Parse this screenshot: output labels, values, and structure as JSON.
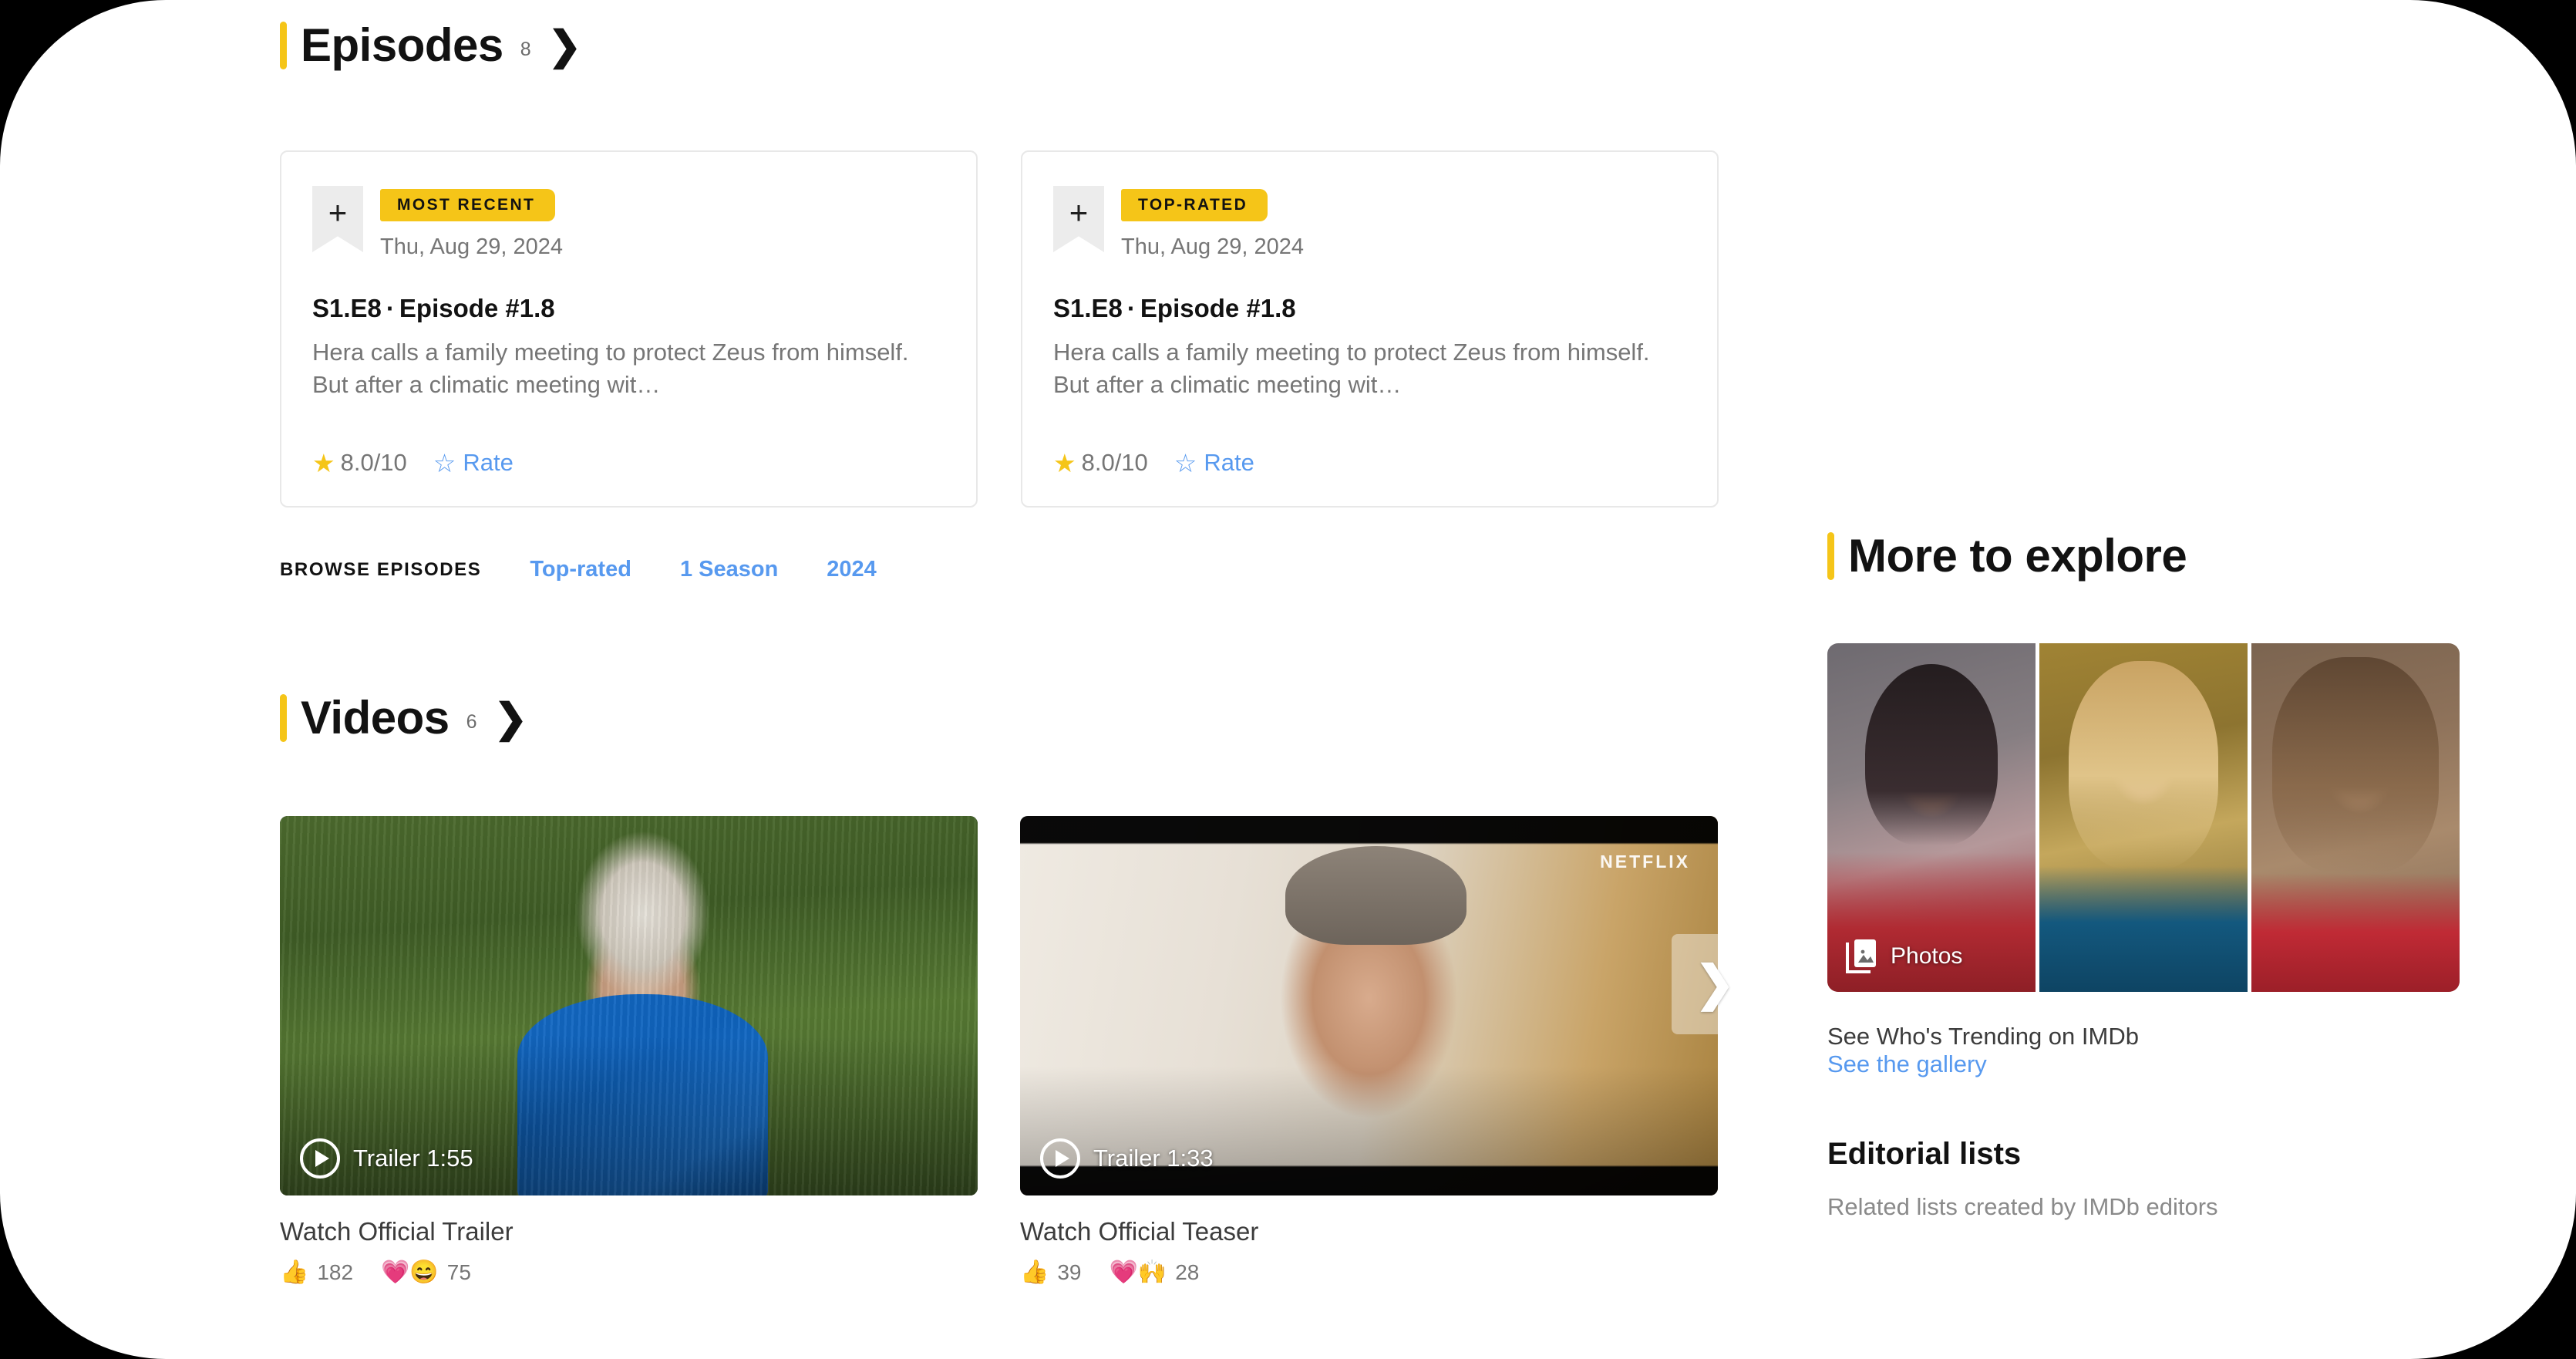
{
  "episodes": {
    "title": "Episodes",
    "count": "8",
    "chevron": "❯",
    "cards": [
      {
        "badge": "MOST RECENT",
        "add_icon": "+",
        "date": "Thu, Aug 29, 2024",
        "season_episode": "S1.E8",
        "separator": "·",
        "name": "Episode #1.8",
        "description": "Hera calls a family meeting to protect Zeus from himself. But after a climatic meeting wit…",
        "rating": "8.0/10",
        "star_filled": "★",
        "star_outline": "☆",
        "rate_label": "Rate"
      },
      {
        "badge": "TOP-RATED",
        "add_icon": "+",
        "date": "Thu, Aug 29, 2024",
        "season_episode": "S1.E8",
        "separator": "·",
        "name": "Episode #1.8",
        "description": "Hera calls a family meeting to protect Zeus from himself. But after a climatic meeting wit…",
        "rating": "8.0/10",
        "star_filled": "★",
        "star_outline": "☆",
        "rate_label": "Rate"
      }
    ],
    "browse": {
      "label": "BROWSE EPISODES",
      "links": [
        "Top-rated",
        "1 Season",
        "2024"
      ]
    }
  },
  "videos": {
    "title": "Videos",
    "count": "6",
    "chevron": "❯",
    "next_chevron": "❯",
    "cards": [
      {
        "duration_label": "Trailer 1:55",
        "caption": "Watch Official Trailer",
        "watermark": "",
        "reactions": [
          {
            "icon": "👍",
            "count": "182"
          },
          {
            "icon": "💗😄",
            "count": "75"
          }
        ]
      },
      {
        "duration_label": "Trailer 1:33",
        "caption": "Watch Official Teaser",
        "watermark": "NETFLIX",
        "reactions": [
          {
            "icon": "👍",
            "count": "39"
          },
          {
            "icon": "💗🙌",
            "count": "28"
          }
        ]
      }
    ]
  },
  "sidebar": {
    "title": "More to explore",
    "photos_badge": "Photos",
    "gallery_caption": "See Who's Trending on IMDb",
    "gallery_link": "See the gallery",
    "editorial_title": "Editorial lists",
    "editorial_subtitle": "Related lists created by IMDb editors"
  },
  "colors": {
    "accent": "#f5c518",
    "link": "#5799ef",
    "text": "#121212",
    "muted": "#767676"
  }
}
